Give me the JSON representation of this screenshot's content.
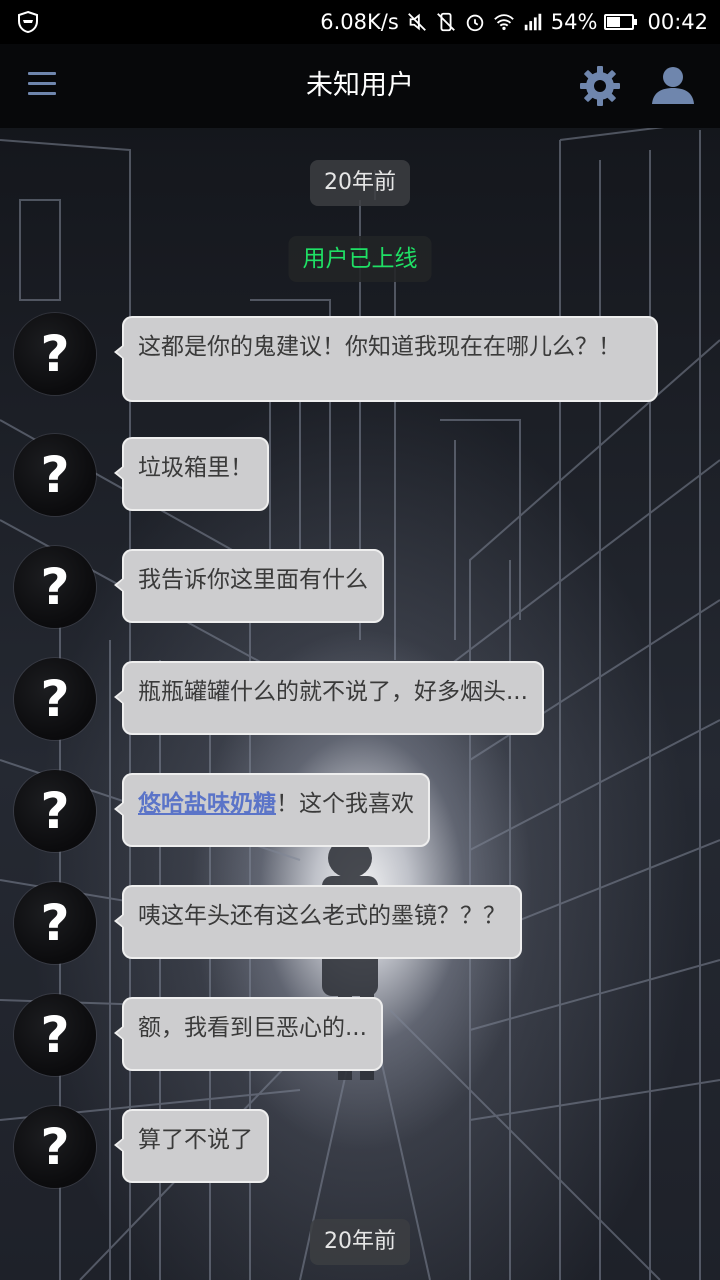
{
  "status_bar": {
    "network_speed": "6.08K/s",
    "battery_percent": "54%",
    "battery_level": 0.54,
    "time": "00:42",
    "icons": [
      "shield-icon",
      "mute-icon",
      "vibrate-off-icon",
      "alarm-icon",
      "wifi-icon",
      "signal-icon",
      "battery-icon"
    ]
  },
  "header": {
    "title": "未知用户",
    "icons": [
      "menu-icon",
      "gear-icon",
      "user-icon"
    ],
    "accent_color": "#6f86ad"
  },
  "chat": {
    "top_timestamp": "20年前",
    "online_status": "用户已上线",
    "online_color": "#1fe065",
    "avatar_glyph": "?",
    "messages": [
      {
        "text": "这都是你的鬼建议！你知道我现在在哪儿么？！"
      },
      {
        "text": "垃圾箱里！"
      },
      {
        "text": "我告诉你这里面有什么"
      },
      {
        "text": "瓶瓶罐罐什么的就不说了，好多烟头..."
      },
      {
        "link": "悠哈盐味奶糖",
        "text": "！这个我喜欢"
      },
      {
        "text": "咦这年头还有这么老式的墨镜？？？"
      },
      {
        "text": "额，我看到巨恶心的..."
      },
      {
        "text": "算了不说了"
      }
    ],
    "bottom_timestamp": "20年前"
  }
}
